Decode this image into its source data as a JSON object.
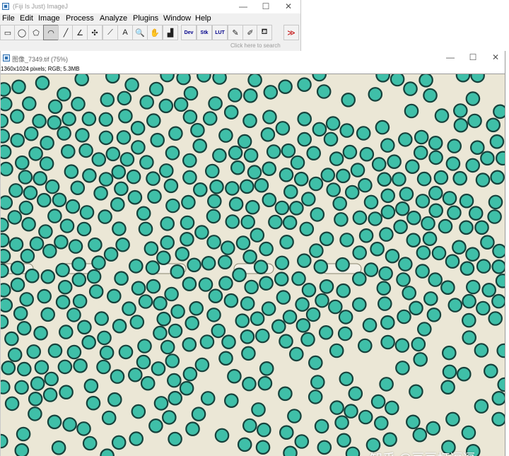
{
  "fiji_window": {
    "title": "(Fiji Is Just) ImageJ",
    "controls": {
      "minimize": "—",
      "maximize": "☐",
      "close": "✕"
    },
    "menus": [
      "File",
      "Edit",
      "Image",
      "Process",
      "Analyze",
      "Plugins",
      "Window",
      "Help"
    ],
    "tools": [
      {
        "name": "rectangle-tool-icon",
        "glyph": "▭"
      },
      {
        "name": "oval-tool-icon",
        "glyph": "◯"
      },
      {
        "name": "polygon-tool-icon",
        "glyph": "⬠"
      },
      {
        "name": "freehand-tool-icon",
        "glyph": "◠"
      },
      {
        "name": "line-tool-icon",
        "glyph": "╱"
      },
      {
        "name": "angle-tool-icon",
        "glyph": "∠"
      },
      {
        "name": "point-tool-icon",
        "glyph": "✣"
      },
      {
        "name": "wand-tool-icon",
        "glyph": "⟋"
      },
      {
        "name": "text-tool-icon",
        "glyph": "A"
      },
      {
        "name": "magnifier-tool-icon",
        "glyph": "🔍"
      },
      {
        "name": "hand-tool-icon",
        "glyph": "✋"
      },
      {
        "name": "color-picker-tool-icon",
        "glyph": "▟"
      },
      {
        "name": "dev-tool-icon",
        "glyph": "Dev"
      },
      {
        "name": "stk-tool-icon",
        "glyph": "Stk"
      },
      {
        "name": "lut-tool-icon",
        "glyph": "LUT"
      },
      {
        "name": "pencil-tool-icon",
        "glyph": "✎"
      },
      {
        "name": "brush-tool-icon",
        "glyph": "✐"
      },
      {
        "name": "flood-fill-tool-icon",
        "glyph": "⛾"
      },
      {
        "name": "more-tools-icon",
        "glyph": "≫"
      }
    ],
    "search_placeholder": "Click here to search"
  },
  "image_window": {
    "title": "图像_7349.tif (75%)",
    "info": "1360x1024 pixels; RGB; 5.3MB",
    "controls": {
      "minimize": "—",
      "maximize": "☐",
      "close": "✕"
    },
    "watermark": "知乎 @豆豆打逗逗",
    "colors": {
      "background": "#ebe7d6",
      "droplet_fill": "#3fbfa8",
      "droplet_ring": "#16423c",
      "channel_post": "#f3f0e6"
    }
  }
}
